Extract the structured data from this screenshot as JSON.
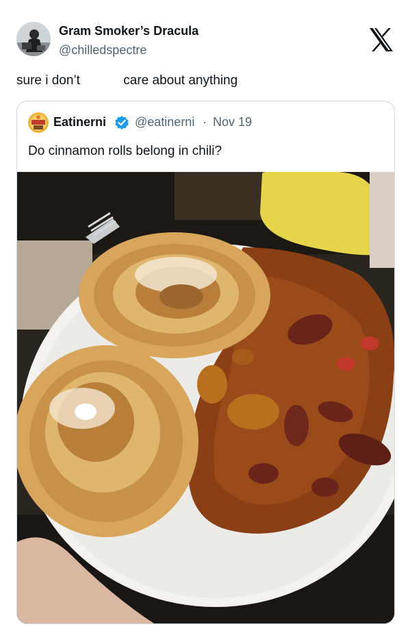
{
  "tweet": {
    "author": {
      "name": "Gram Smoker’s Dracula",
      "handle": "@chilledspectre"
    },
    "text": "sure i don’t            care about anything"
  },
  "quoted_tweet": {
    "author": {
      "name": "Eatinerni",
      "handle": "@eatinerni"
    },
    "separator": "·",
    "date": "Nov 19",
    "text": "Do cinnamon rolls belong in chili?"
  },
  "icons": {
    "platform_logo": "x-logo-icon",
    "verified_badge": "verified-badge-icon"
  },
  "colors": {
    "text": "#0f1419",
    "secondary_text": "#536471",
    "border": "#cfd9de",
    "verified": "#1d9bf0"
  }
}
